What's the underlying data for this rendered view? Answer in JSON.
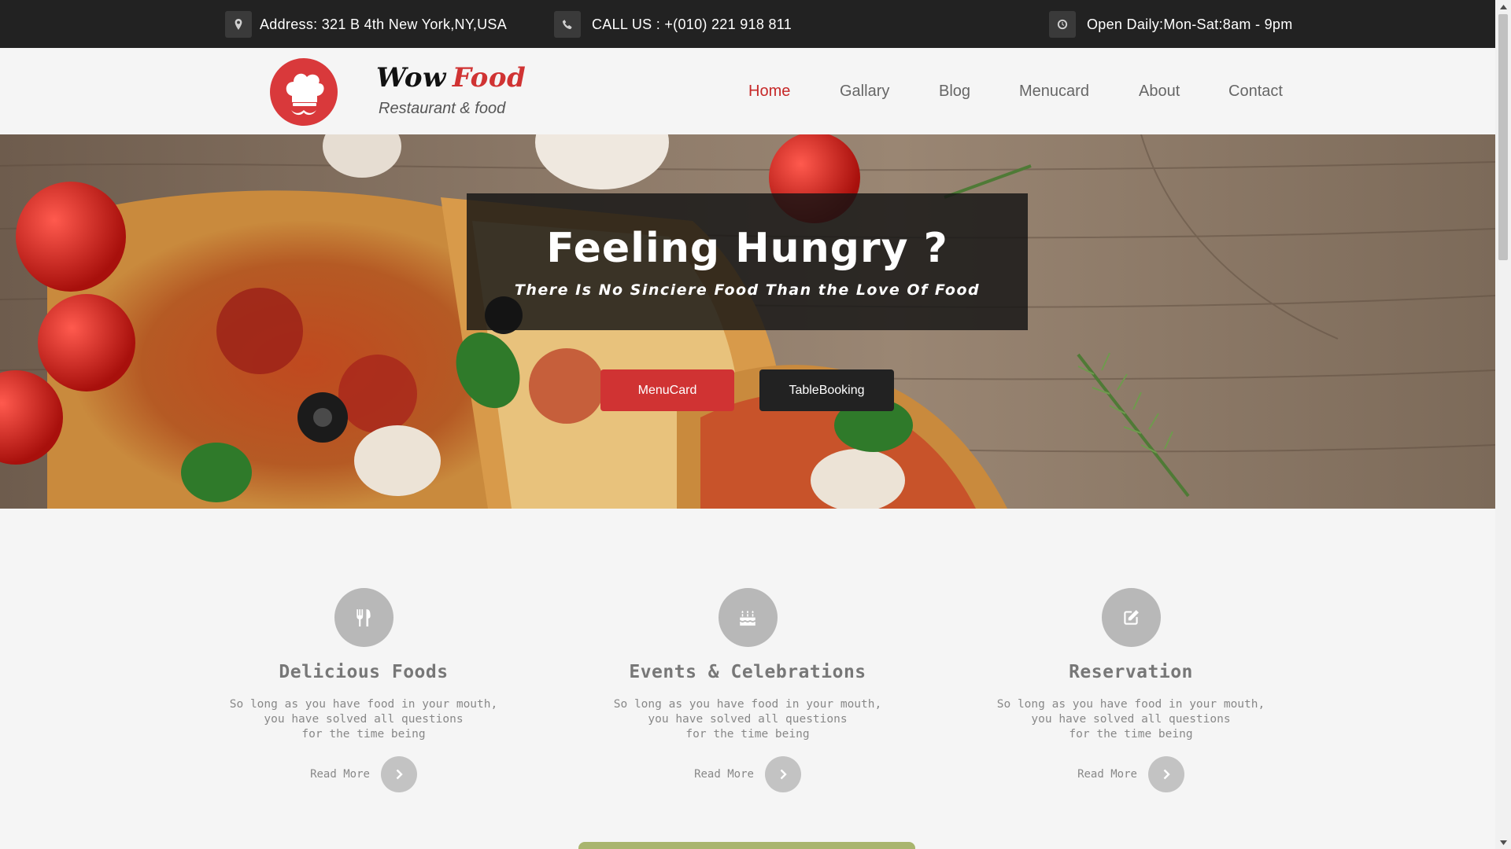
{
  "topbar": {
    "address": "Address: 321 B 4th New York,NY,USA",
    "address_icon": "map-marker-icon",
    "phone": "CALL US : +(010) 221 918 811",
    "phone_icon": "phone-icon",
    "hours": "Open Daily:Mon-Sat:8am - 9pm",
    "hours_icon": "clock-icon"
  },
  "header": {
    "brand_word1": "Wow",
    "brand_word2": "Food",
    "tagline": "Restaurant & food",
    "logo_icon": "chef-hat-mustache-icon",
    "nav": [
      "Home",
      "Gallary",
      "Blog",
      "Menucard",
      "About",
      "Contact"
    ],
    "active_nav": "Home"
  },
  "hero": {
    "title": "Feeling Hungry ?",
    "subtitle": "There Is No Sinciere Food Than the Love Of Food",
    "button_primary": "MenuCard",
    "button_secondary": "TableBooking"
  },
  "features": [
    {
      "icon": "cutlery-icon",
      "title": "Delicious Foods",
      "text": [
        "So long as you have food in your mouth,",
        "you have solved all questions",
        "for the time being"
      ],
      "link": "Read More"
    },
    {
      "icon": "birthday-cake-icon",
      "title": "Events & Celebrations",
      "text": [
        "So long as you have food in your mouth,",
        "you have solved all questions",
        "for the time being"
      ],
      "link": "Read More"
    },
    {
      "icon": "edit-icon",
      "title": "Reservation",
      "text": [
        "So long as you have food in your mouth,",
        "you have solved all questions",
        "for the time being"
      ],
      "link": "Read More"
    }
  ],
  "colors": {
    "accent_red": "#d03333",
    "dark": "#222222",
    "green_bar": "#a9b56e"
  }
}
